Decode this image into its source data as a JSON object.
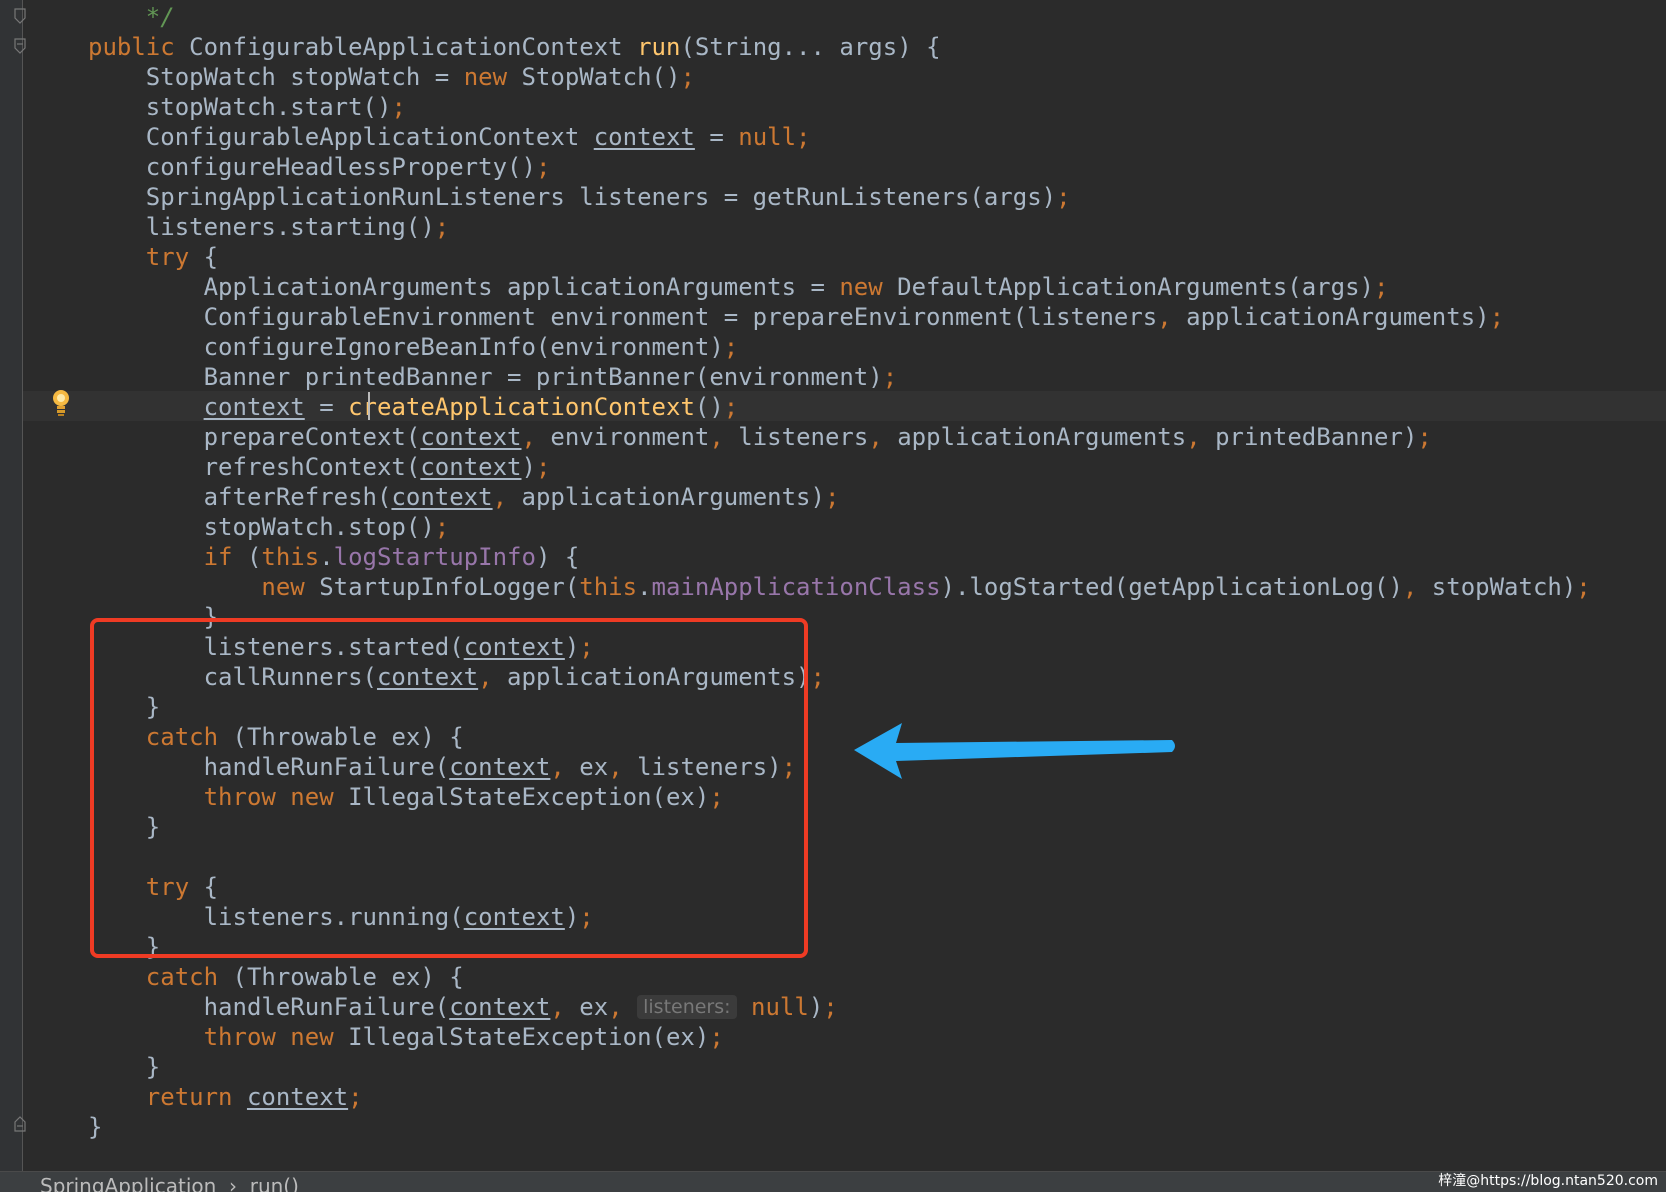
{
  "editor": {
    "lines": [
      {
        "indent": "    ",
        "tokens": [
          {
            "t": "*/",
            "c": "cmt"
          }
        ]
      },
      {
        "indent": "",
        "tokens": [
          {
            "t": "public ",
            "c": "kw"
          },
          {
            "t": "ConfigurableApplicationContext "
          },
          {
            "t": "run",
            "c": "fn"
          },
          {
            "t": "(String... args) {"
          }
        ]
      },
      {
        "indent": "    ",
        "tokens": [
          {
            "t": "StopWatch stopWatch = "
          },
          {
            "t": "new ",
            "c": "kw"
          },
          {
            "t": "StopWatch()"
          },
          {
            "t": ";",
            "c": "sp"
          }
        ]
      },
      {
        "indent": "    ",
        "tokens": [
          {
            "t": "stopWatch.start()"
          },
          {
            "t": ";",
            "c": "sp"
          }
        ]
      },
      {
        "indent": "    ",
        "tokens": [
          {
            "t": "ConfigurableApplicationContext "
          },
          {
            "t": "context",
            "c": "u"
          },
          {
            "t": " = "
          },
          {
            "t": "null",
            "c": "kw"
          },
          {
            "t": ";",
            "c": "sp"
          }
        ]
      },
      {
        "indent": "    ",
        "tokens": [
          {
            "t": "configureHeadlessProperty()"
          },
          {
            "t": ";",
            "c": "sp"
          }
        ]
      },
      {
        "indent": "    ",
        "tokens": [
          {
            "t": "SpringApplicationRunListeners listeners = getRunListeners(args)"
          },
          {
            "t": ";",
            "c": "sp"
          }
        ]
      },
      {
        "indent": "    ",
        "tokens": [
          {
            "t": "listeners.starting()"
          },
          {
            "t": ";",
            "c": "sp"
          }
        ]
      },
      {
        "indent": "    ",
        "tokens": [
          {
            "t": "try ",
            "c": "kw"
          },
          {
            "t": "{"
          }
        ]
      },
      {
        "indent": "        ",
        "tokens": [
          {
            "t": "ApplicationArguments applicationArguments = "
          },
          {
            "t": "new ",
            "c": "kw"
          },
          {
            "t": "DefaultApplicationArguments(args)"
          },
          {
            "t": ";",
            "c": "sp"
          }
        ]
      },
      {
        "indent": "        ",
        "tokens": [
          {
            "t": "ConfigurableEnvironment environment = prepareEnvironment(listeners"
          },
          {
            "t": ", ",
            "c": "sp"
          },
          {
            "t": "applicationArguments)"
          },
          {
            "t": ";",
            "c": "sp"
          }
        ]
      },
      {
        "indent": "        ",
        "tokens": [
          {
            "t": "configureIgnoreBeanInfo(environment)"
          },
          {
            "t": ";",
            "c": "sp"
          }
        ]
      },
      {
        "indent": "        ",
        "tokens": [
          {
            "t": "Banner printedBanner = printBanner(environment)"
          },
          {
            "t": ";",
            "c": "sp"
          }
        ]
      },
      {
        "indent": "        ",
        "tokens": [
          {
            "t": "context",
            "c": "u"
          },
          {
            "t": " = "
          },
          {
            "t": "createApplicationContext",
            "c": "fn"
          },
          {
            "t": "()"
          },
          {
            "t": ";",
            "c": "sp"
          }
        ]
      },
      {
        "indent": "        ",
        "tokens": [
          {
            "t": "prepareContext("
          },
          {
            "t": "context",
            "c": "u"
          },
          {
            "t": ", ",
            "c": "sp"
          },
          {
            "t": "environment"
          },
          {
            "t": ", ",
            "c": "sp"
          },
          {
            "t": "listeners"
          },
          {
            "t": ", ",
            "c": "sp"
          },
          {
            "t": "applicationArguments"
          },
          {
            "t": ", ",
            "c": "sp"
          },
          {
            "t": "printedBanner)"
          },
          {
            "t": ";",
            "c": "sp"
          }
        ]
      },
      {
        "indent": "        ",
        "tokens": [
          {
            "t": "refreshContext("
          },
          {
            "t": "context",
            "c": "u"
          },
          {
            "t": ")"
          },
          {
            "t": ";",
            "c": "sp"
          }
        ]
      },
      {
        "indent": "        ",
        "tokens": [
          {
            "t": "afterRefresh("
          },
          {
            "t": "context",
            "c": "u"
          },
          {
            "t": ", ",
            "c": "sp"
          },
          {
            "t": "applicationArguments)"
          },
          {
            "t": ";",
            "c": "sp"
          }
        ]
      },
      {
        "indent": "        ",
        "tokens": [
          {
            "t": "stopWatch.stop()"
          },
          {
            "t": ";",
            "c": "sp"
          }
        ]
      },
      {
        "indent": "        ",
        "tokens": [
          {
            "t": "if ",
            "c": "kw"
          },
          {
            "t": "("
          },
          {
            "t": "this",
            "c": "kw"
          },
          {
            "t": "."
          },
          {
            "t": "logStartupInfo",
            "c": "fld"
          },
          {
            "t": ") {"
          }
        ]
      },
      {
        "indent": "            ",
        "tokens": [
          {
            "t": "new ",
            "c": "kw"
          },
          {
            "t": "StartupInfoLogger("
          },
          {
            "t": "this",
            "c": "kw"
          },
          {
            "t": "."
          },
          {
            "t": "mainApplicationClass",
            "c": "fld"
          },
          {
            "t": ").logStarted(getApplicationLog()"
          },
          {
            "t": ", ",
            "c": "sp"
          },
          {
            "t": "stopWatch)"
          },
          {
            "t": ";",
            "c": "sp"
          }
        ]
      },
      {
        "indent": "        ",
        "tokens": [
          {
            "t": "}"
          }
        ]
      },
      {
        "indent": "        ",
        "tokens": [
          {
            "t": "listeners.started("
          },
          {
            "t": "context",
            "c": "u"
          },
          {
            "t": ")"
          },
          {
            "t": ";",
            "c": "sp"
          }
        ]
      },
      {
        "indent": "        ",
        "tokens": [
          {
            "t": "callRunners("
          },
          {
            "t": "context",
            "c": "u"
          },
          {
            "t": ", ",
            "c": "sp"
          },
          {
            "t": "applicationArguments)"
          },
          {
            "t": ";",
            "c": "sp"
          }
        ]
      },
      {
        "indent": "    ",
        "tokens": [
          {
            "t": "}"
          }
        ]
      },
      {
        "indent": "    ",
        "tokens": [
          {
            "t": "catch ",
            "c": "kw"
          },
          {
            "t": "(Throwable ex) {"
          }
        ]
      },
      {
        "indent": "        ",
        "tokens": [
          {
            "t": "handleRunFailure("
          },
          {
            "t": "context",
            "c": "u"
          },
          {
            "t": ", ",
            "c": "sp"
          },
          {
            "t": "ex"
          },
          {
            "t": ", ",
            "c": "sp"
          },
          {
            "t": "listeners)"
          },
          {
            "t": ";",
            "c": "sp"
          }
        ]
      },
      {
        "indent": "        ",
        "tokens": [
          {
            "t": "throw ",
            "c": "kw"
          },
          {
            "t": "new ",
            "c": "kw"
          },
          {
            "t": "IllegalStateException(ex)"
          },
          {
            "t": ";",
            "c": "sp"
          }
        ]
      },
      {
        "indent": "    ",
        "tokens": [
          {
            "t": "}"
          }
        ]
      },
      {
        "indent": "",
        "tokens": []
      },
      {
        "indent": "    ",
        "tokens": [
          {
            "t": "try ",
            "c": "kw"
          },
          {
            "t": "{"
          }
        ]
      },
      {
        "indent": "        ",
        "tokens": [
          {
            "t": "listeners.running("
          },
          {
            "t": "context",
            "c": "u"
          },
          {
            "t": ")"
          },
          {
            "t": ";",
            "c": "sp"
          }
        ]
      },
      {
        "indent": "    ",
        "tokens": [
          {
            "t": "}"
          }
        ]
      },
      {
        "indent": "    ",
        "tokens": [
          {
            "t": "catch ",
            "c": "kw"
          },
          {
            "t": "(Throwable ex) {"
          }
        ]
      },
      {
        "indent": "        ",
        "tokens": [
          {
            "t": "handleRunFailure("
          },
          {
            "t": "context",
            "c": "u"
          },
          {
            "t": ", ",
            "c": "sp"
          },
          {
            "t": "ex"
          },
          {
            "t": ", ",
            "c": "sp"
          },
          {
            "t": "listeners:",
            "c": "hint"
          },
          {
            "t": " "
          },
          {
            "t": "null",
            "c": "kw"
          },
          {
            "t": ")"
          },
          {
            "t": ";",
            "c": "sp"
          }
        ]
      },
      {
        "indent": "        ",
        "tokens": [
          {
            "t": "throw ",
            "c": "kw"
          },
          {
            "t": "new ",
            "c": "kw"
          },
          {
            "t": "IllegalStateException(ex)"
          },
          {
            "t": ";",
            "c": "sp"
          }
        ]
      },
      {
        "indent": "    ",
        "tokens": [
          {
            "t": "}"
          }
        ]
      },
      {
        "indent": "    ",
        "tokens": [
          {
            "t": "return ",
            "c": "kw"
          },
          {
            "t": "context",
            "c": "u"
          },
          {
            "t": ";",
            "c": "sp"
          }
        ]
      },
      {
        "indent": "",
        "tokens": [
          {
            "t": "}"
          }
        ]
      }
    ]
  },
  "statusbar": {
    "breadcrumb": "SpringApplication  ›  run()"
  },
  "watermark": "梓潼@https://blog.ntan520.com",
  "icons": {
    "bulb": "lightbulb-icon",
    "fold": "fold-marker-icon",
    "arrow": "annotation-arrow"
  },
  "colors": {
    "background": "#2b2b2b",
    "keyword": "#cc7832",
    "method": "#ffc66d",
    "field": "#9876aa",
    "text": "#a9b7c6",
    "box": "#ef3b24",
    "arrow": "#29abf4"
  }
}
